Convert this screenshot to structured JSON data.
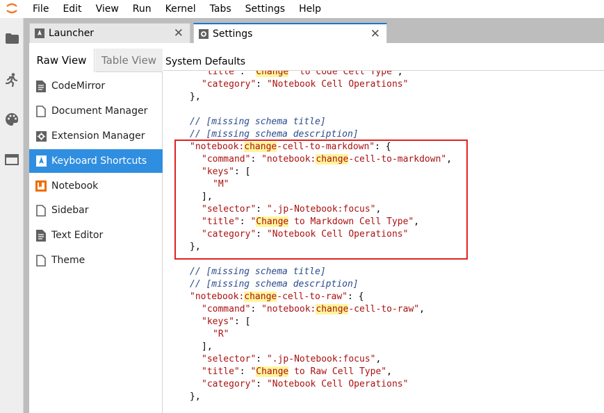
{
  "menu": [
    "File",
    "Edit",
    "View",
    "Run",
    "Kernel",
    "Tabs",
    "Settings",
    "Help"
  ],
  "tabs": [
    {
      "label": "Launcher",
      "icon": "launcher-icon"
    },
    {
      "label": "Settings",
      "icon": "gear-icon"
    }
  ],
  "views": {
    "raw": "Raw View",
    "table": "Table View"
  },
  "plugins": [
    {
      "label": "CodeMirror",
      "icon": "document-icon"
    },
    {
      "label": "Document Manager",
      "icon": "file-outline-icon"
    },
    {
      "label": "Extension Manager",
      "icon": "puzzle-gear-icon"
    },
    {
      "label": "Keyboard Shortcuts",
      "icon": "launcher-icon"
    },
    {
      "label": "Notebook",
      "icon": "notebook-icon"
    },
    {
      "label": "Sidebar",
      "icon": "file-outline-icon"
    },
    {
      "label": "Text Editor",
      "icon": "document-icon"
    },
    {
      "label": "Theme",
      "icon": "file-outline-icon"
    }
  ],
  "editor": {
    "header": "System Defaults"
  },
  "code": {
    "c_title": "// [missing schema title]",
    "c_desc": "// [missing schema description]",
    "l1_title_val": "\" to Code Cell Type\"",
    "category_key": "\"category\"",
    "category_val": "\"Notebook Cell Operations\"",
    "close_brace": "},",
    "notebook_prefix": "\"notebook:",
    "command_key": "\"command\"",
    "keys_key": "\"keys\"",
    "selector_key": "\"selector\"",
    "selector_val": "\".jp-Notebook:focus\"",
    "title_key": "\"title\"",
    "change": "change",
    "Change": "Change",
    "md_suffix": "-cell-to-markdown\"",
    "raw_suffix": "-cell-to-raw\"",
    "key_m": "\"M\"",
    "key_r": "\"R\"",
    "md_title_rest": " to Markdown Cell Type\"",
    "raw_title_rest": " to Raw Cell Type\"",
    "open_bracket": "[",
    "close_bracket": "],",
    "open_brace": "{",
    "colon": ": ",
    "comma": ","
  }
}
